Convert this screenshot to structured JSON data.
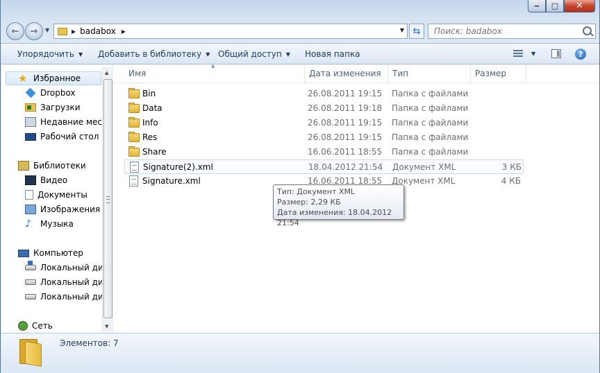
{
  "window": {
    "minimize_glyph": "‒",
    "maximize_glyph": "□",
    "close_glyph": "✕"
  },
  "nav": {
    "back_glyph": "←",
    "forward_glyph": "→"
  },
  "address": {
    "path": "badabox"
  },
  "search": {
    "placeholder": "Поиск: badabox"
  },
  "toolbar": {
    "organize": "Упорядочить",
    "add_to_library": "Добавить в библиотеку",
    "share": "Общий доступ",
    "new_folder": "Новая папка",
    "help": "?"
  },
  "sidebar": {
    "favorites": {
      "label": "Избранное",
      "icon": "star-icon",
      "items": [
        {
          "label": "Dropbox",
          "icon": "dropbox-icon"
        },
        {
          "label": "Загрузки",
          "icon": "downloads-icon"
        },
        {
          "label": "Недавние места",
          "icon": "recent-places-icon"
        },
        {
          "label": "Рабочий стол",
          "icon": "desktop-icon"
        }
      ]
    },
    "libraries": {
      "label": "Библиотеки",
      "icon": "library-icon",
      "items": [
        {
          "label": "Видео",
          "icon": "video-icon"
        },
        {
          "label": "Документы",
          "icon": "documents-icon"
        },
        {
          "label": "Изображения",
          "icon": "pictures-icon"
        },
        {
          "label": "Музыка",
          "icon": "music-icon"
        }
      ]
    },
    "computer": {
      "label": "Компьютер",
      "icon": "computer-icon",
      "items": [
        {
          "label": "Локальный диск",
          "icon": "system-disk-icon"
        },
        {
          "label": "Локальный диск",
          "icon": "disk-icon"
        },
        {
          "label": "Локальный диск",
          "icon": "disk-icon"
        }
      ]
    },
    "network": {
      "label": "Сеть",
      "icon": "network-icon"
    }
  },
  "columns": {
    "name": "Имя",
    "date": "Дата изменения",
    "type": "Тип",
    "size": "Размер"
  },
  "files": [
    {
      "name": "Bin",
      "date": "26.08.2011 19:15",
      "type": "Папка с файлами",
      "size": "",
      "icon": "folder-icon"
    },
    {
      "name": "Data",
      "date": "26.08.2011 19:18",
      "type": "Папка с файлами",
      "size": "",
      "icon": "folder-icon"
    },
    {
      "name": "Info",
      "date": "26.08.2011 19:15",
      "type": "Папка с файлами",
      "size": "",
      "icon": "folder-icon"
    },
    {
      "name": "Res",
      "date": "26.08.2011 19:15",
      "type": "Папка с файлами",
      "size": "",
      "icon": "folder-icon"
    },
    {
      "name": "Share",
      "date": "16.06.2011 18:55",
      "type": "Папка с файлами",
      "size": "",
      "icon": "folder-icon"
    },
    {
      "name": "Signature(2).xml",
      "date": "18.04.2012 21:54",
      "type": "Документ XML",
      "size": "3 КБ",
      "icon": "xml-file-icon"
    },
    {
      "name": "Signature.xml",
      "date": "16.06.2011 18:55",
      "type": "Документ XML",
      "size": "4 КБ",
      "icon": "xml-file-icon"
    }
  ],
  "tooltip": {
    "type_line": "Тип: Документ XML",
    "size_line": "Размер: 2,29 КБ",
    "date_line": "Дата изменения: 18.04.2012 21:54"
  },
  "details": {
    "count": "Элементов: 7"
  }
}
